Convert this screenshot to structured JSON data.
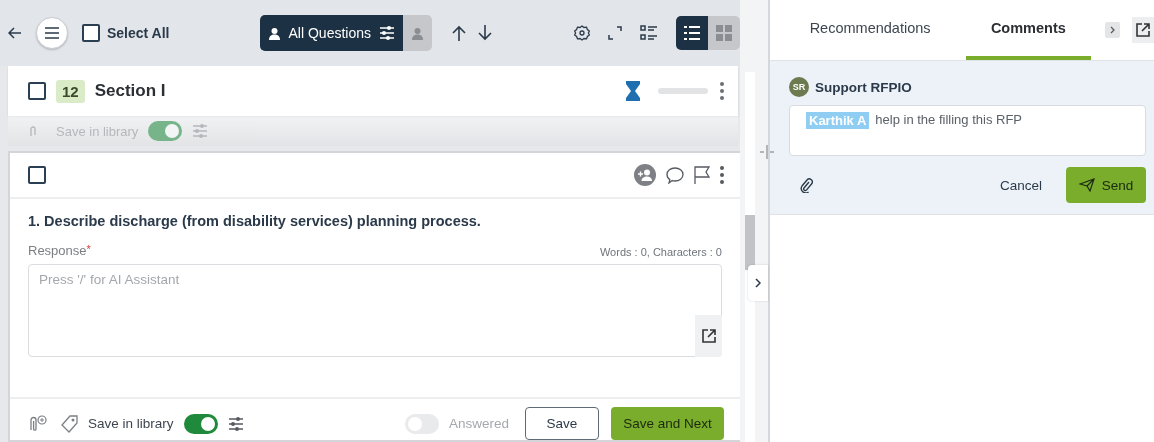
{
  "toolbar": {
    "select_all": {
      "label": "Select All",
      "checked": false
    },
    "view_tabs": [
      {
        "kind": "all",
        "label": "All Questions",
        "selected": true
      },
      {
        "kind": "assigned",
        "selected": false
      }
    ],
    "layout_toggle": [
      {
        "kind": "list",
        "selected": true
      },
      {
        "kind": "grid",
        "selected": false
      }
    ]
  },
  "section": {
    "number": "12",
    "title": "Section I",
    "checked": false,
    "level": 0,
    "faded_row": {
      "label": "Save in library",
      "on": true
    }
  },
  "question": {
    "checked": false,
    "text": "1. Describe discharge (from disability services) planning process.",
    "response_label": "Response",
    "required_mark": "*",
    "counter": "Words : 0, Characters : 0",
    "placeholder": "Press '/' for AI Assistant",
    "save_in_library": {
      "label": "Save in library",
      "on": true
    },
    "answered": {
      "label": "Answered",
      "on": false
    },
    "buttons": [
      "Save",
      "Save and Next"
    ]
  },
  "panel": {
    "tabs": [
      {
        "label": "Recommendations",
        "selected": false
      },
      {
        "label": "Comments",
        "selected": true
      }
    ],
    "comment": {
      "avatar": "SR",
      "author": "Support RFPIO",
      "mention": "Karthik A",
      "text": "help in the filling this RFP"
    },
    "buttons": [
      "Cancel",
      "Send"
    ]
  }
}
